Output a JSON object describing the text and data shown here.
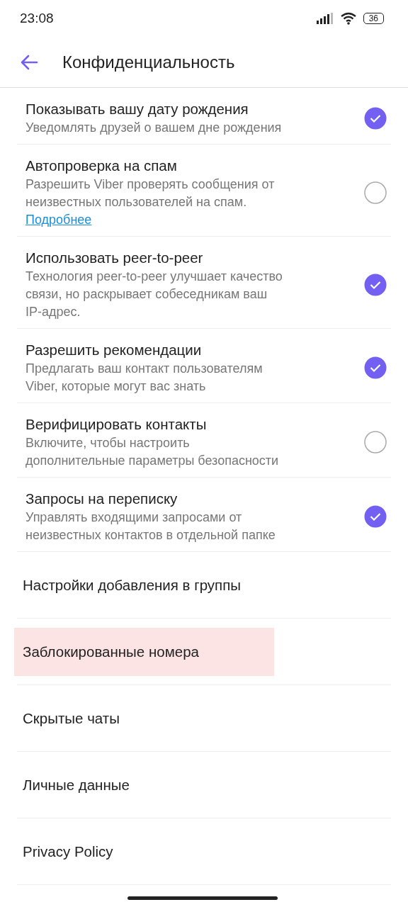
{
  "status_bar": {
    "time": "23:08",
    "battery": "36"
  },
  "header": {
    "title": "Конфиденциальность"
  },
  "settings": [
    {
      "title": "Показывать вашу дату рождения",
      "description": [
        "Уведомлять друзей о вашем дне рождения"
      ],
      "checked": true
    },
    {
      "title": "Автопроверка на спам",
      "description": [
        "Разрешить Viber проверять сообщения от",
        "неизвестных пользователей на спам."
      ],
      "link": "Подробнее",
      "checked": false
    },
    {
      "title": "Использовать peer-to-peer",
      "description": [
        "Технология peer-to-peer улучшает качество",
        "связи, но раскрывает собеседникам ваш",
        "IP-адрес."
      ],
      "checked": true
    },
    {
      "title": "Разрешить рекомендации",
      "description": [
        "Предлагать ваш контакт пользователям",
        "Viber, которые могут вас знать"
      ],
      "checked": true
    },
    {
      "title": "Верифицировать контакты",
      "description": [
        "Включите, чтобы настроить",
        "дополнительные параметры безопасности"
      ],
      "checked": false
    },
    {
      "title": "Запросы на переписку",
      "description": [
        "Управлять входящими запросами от",
        "неизвестных контактов в отдельной папке"
      ],
      "checked": true
    }
  ],
  "links": [
    {
      "label": "Настройки добавления в группы",
      "highlighted": false
    },
    {
      "label": "Заблокированные номера",
      "highlighted": true
    },
    {
      "label": "Скрытые чаты",
      "highlighted": false
    },
    {
      "label": "Личные данные",
      "highlighted": false
    },
    {
      "label": "Privacy Policy",
      "highlighted": false
    }
  ]
}
